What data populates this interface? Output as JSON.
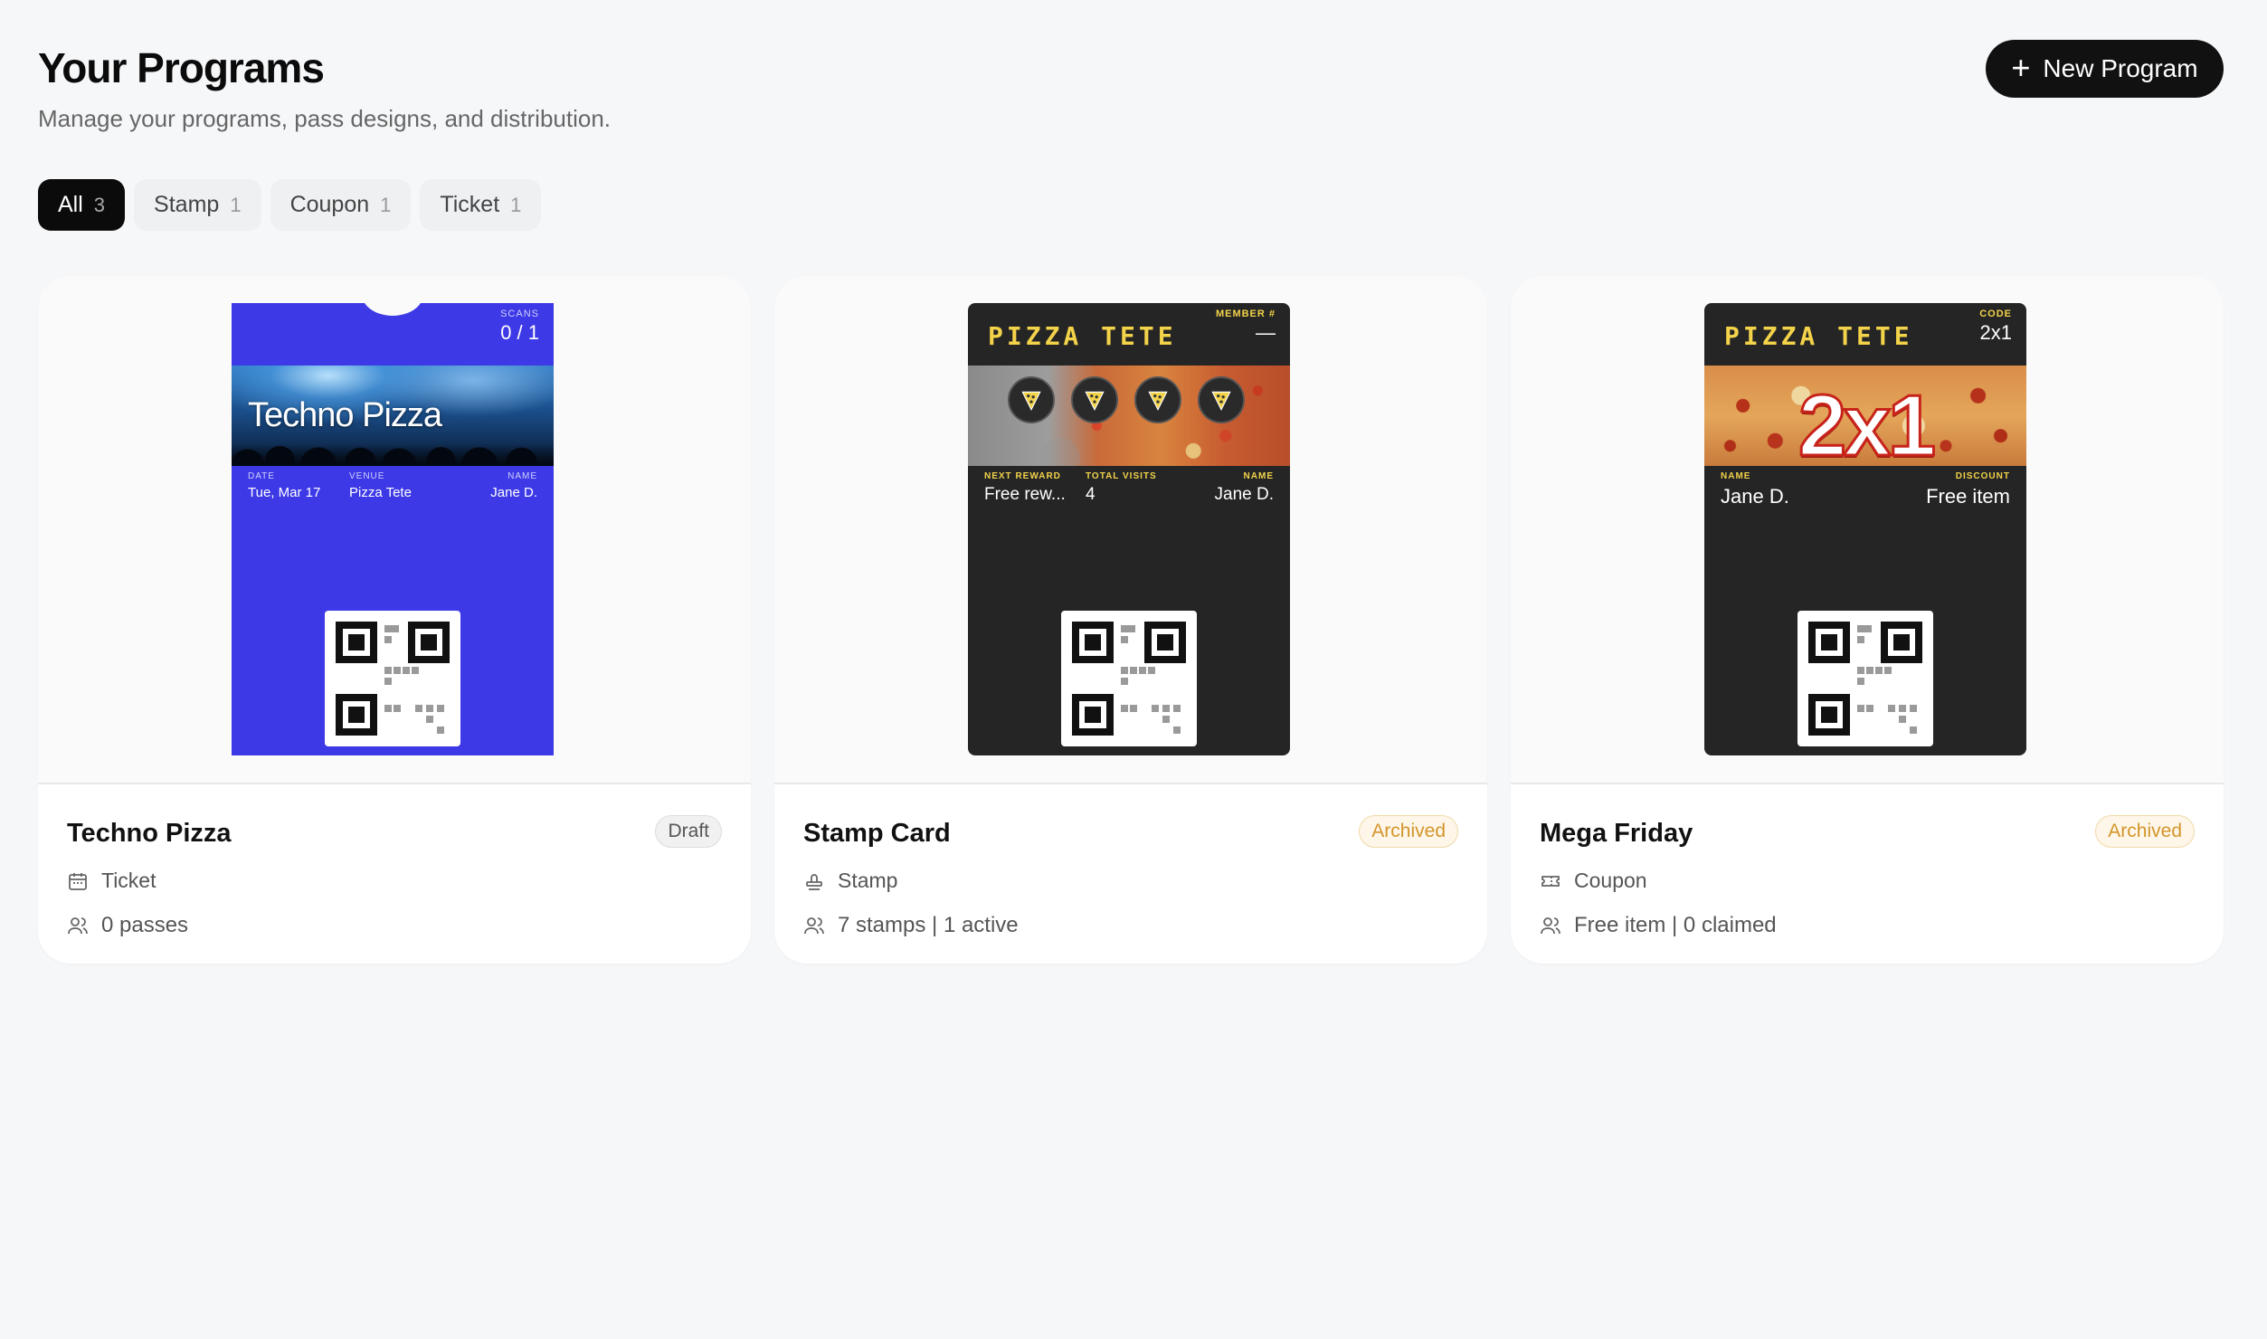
{
  "header": {
    "title": "Your Programs",
    "subtitle": "Manage your programs, pass designs, and distribution.",
    "new_button_label": "New Program"
  },
  "tabs": [
    {
      "label": "All",
      "count": "3",
      "active": true
    },
    {
      "label": "Stamp",
      "count": "1",
      "active": false
    },
    {
      "label": "Coupon",
      "count": "1",
      "active": false
    },
    {
      "label": "Ticket",
      "count": "1",
      "active": false
    }
  ],
  "cards": [
    {
      "title": "Techno Pizza",
      "status": "Draft",
      "type_label": "Ticket",
      "type_icon": "calendar-icon",
      "stats": "0 passes",
      "pass": {
        "header_label": "SCANS",
        "header_value": "0 / 1",
        "strip_title": "Techno Pizza",
        "fields": [
          {
            "label": "DATE",
            "value": "Tue, Mar 17"
          },
          {
            "label": "VENUE",
            "value": "Pizza Tete"
          },
          {
            "label": "NAME",
            "value": "Jane D."
          }
        ]
      }
    },
    {
      "title": "Stamp Card",
      "status": "Archived",
      "type_label": "Stamp",
      "type_icon": "stamp-icon",
      "stats": "7 stamps | 1 active",
      "pass": {
        "brand": "PIZZA TETE",
        "header_label": "MEMBER #",
        "header_value": "—",
        "fields": [
          {
            "label": "NEXT REWARD",
            "value": "Free rew..."
          },
          {
            "label": "TOTAL VISITS",
            "value": "4"
          },
          {
            "label": "NAME",
            "value": "Jane D."
          }
        ]
      }
    },
    {
      "title": "Mega Friday",
      "status": "Archived",
      "type_label": "Coupon",
      "type_icon": "ticket-icon",
      "stats": "Free item | 0 claimed",
      "pass": {
        "brand": "PIZZA TETE",
        "header_label": "CODE",
        "header_value": "2x1",
        "strip_text": "2x1",
        "fields": [
          {
            "label": "NAME",
            "value": "Jane D."
          },
          {
            "label": "DISCOUNT",
            "value": "Free item"
          }
        ]
      }
    }
  ],
  "colors": {
    "ticket_bg": "#3d39e6",
    "dark_pass_bg": "#252525",
    "brand_yellow": "#f3d34a",
    "archived": "#d4952a"
  }
}
